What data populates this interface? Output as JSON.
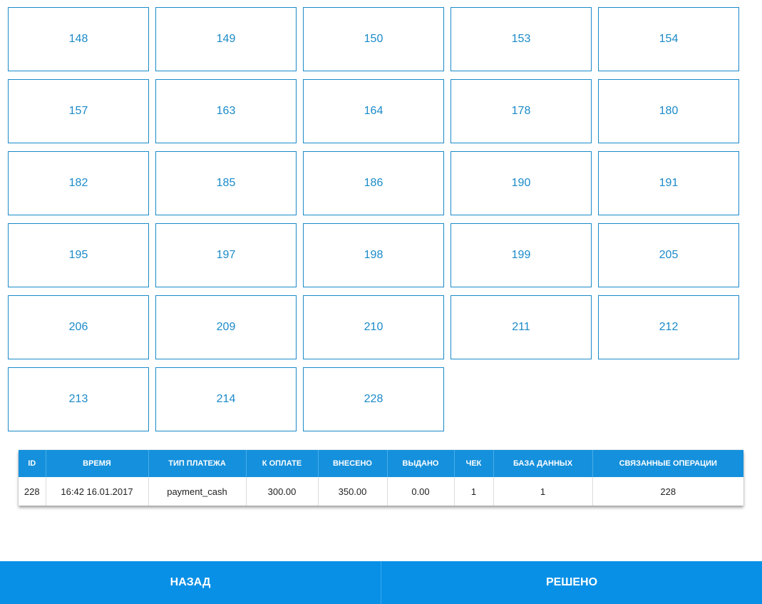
{
  "tiles": [
    "148",
    "149",
    "150",
    "153",
    "154",
    "157",
    "163",
    "164",
    "178",
    "180",
    "182",
    "185",
    "186",
    "190",
    "191",
    "195",
    "197",
    "198",
    "199",
    "205",
    "206",
    "209",
    "210",
    "211",
    "212",
    "213",
    "214",
    "228"
  ],
  "table": {
    "headers": [
      "ID",
      "ВРЕМЯ",
      "ТИП ПЛАТЕЖА",
      "К ОПЛАТЕ",
      "ВНЕСЕНО",
      "ВЫДАНО",
      "ЧЕК",
      "БАЗА ДАННЫХ",
      "СВЯЗАННЫЕ ОПЕРАЦИИ"
    ],
    "rows": [
      [
        "228",
        "16:42 16.01.2017",
        "payment_cash",
        "300.00",
        "350.00",
        "0.00",
        "1",
        "1",
        "228"
      ]
    ]
  },
  "footer": {
    "back_label": "НАЗАД",
    "resolved_label": "РЕШЕНО"
  },
  "colors": {
    "accent": "#1a8ac8",
    "header_bg": "#1590dc",
    "footer_bg": "#0890e6"
  }
}
